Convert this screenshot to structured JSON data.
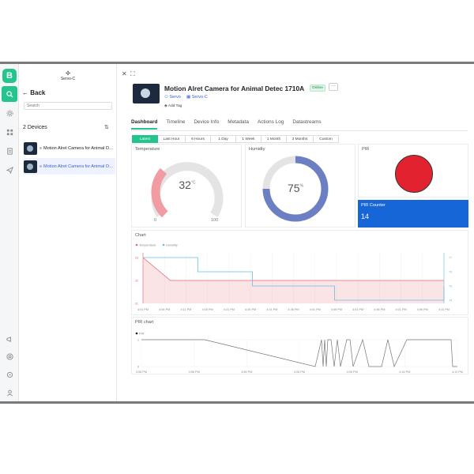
{
  "sidebar": {
    "logo": "B"
  },
  "devices_panel": {
    "org": "Servo-C",
    "back_label": "Back",
    "search_placeholder": "Search",
    "count_label": "2 Devices",
    "items": [
      {
        "name": "Motion Alret Camera for Animal Detec"
      },
      {
        "name": "Motion Alret Camera for Animal Detec"
      }
    ]
  },
  "device": {
    "title": "Motion Alret Camera for Animal Detec 1710A",
    "status": "Online",
    "template": "Servo",
    "org": "Servo-C",
    "add_tag": "Add Tag"
  },
  "tabs": [
    "Dashboard",
    "Timeline",
    "Device Info",
    "Metadata",
    "Actions Log",
    "Datastreams"
  ],
  "ranges": [
    "Latest",
    "Last Hour",
    "6 Hours",
    "1 Day",
    "1 Week",
    "1 Month",
    "3 Months",
    "Custom"
  ],
  "widgets": {
    "temperature": {
      "title": "Temperature",
      "value": "32",
      "unit": "°C",
      "min": "0",
      "max": "100",
      "level": 0.32,
      "color": "#f09ca2"
    },
    "humidity": {
      "title": "Humidty",
      "value": "75",
      "unit": "%",
      "level": 0.75,
      "color": "#6c7fc2"
    },
    "pir": {
      "title": "PIR",
      "color": "#e2232f"
    },
    "pir_counter": {
      "title": "PIR Counter",
      "value": "14",
      "color": "#1666d8"
    }
  },
  "chart_data": [
    {
      "type": "line",
      "title": "Chart",
      "series": [
        {
          "name": "Temperature",
          "color": "#e26a72",
          "values": [
            33,
            32,
            32,
            32,
            32,
            32,
            32,
            32,
            32,
            32,
            32,
            32
          ]
        },
        {
          "name": "Humidity",
          "color": "#66bde8",
          "values": [
            77,
            77,
            76,
            76,
            75,
            75,
            75,
            74,
            74,
            74,
            74,
            75
          ]
        }
      ],
      "x": [
        "4:01 PM",
        "4:06 PM",
        "4:11 PM",
        "4:16 PM",
        "4:21 PM",
        "4:26 PM",
        "4:31 PM",
        "4:36 PM",
        "4:41 PM",
        "4:46 PM",
        "4:51 PM",
        "4:56 PM",
        "4:01 PM",
        "4:06 PM",
        "4:11 PM"
      ],
      "y_left_ticks": [
        "33",
        "32",
        "31"
      ],
      "y_right_ticks": [
        "77",
        "76",
        "75",
        "74"
      ]
    },
    {
      "type": "line",
      "title": "PIR chart",
      "series": [
        {
          "name": "PIR",
          "color": "#777777"
        }
      ],
      "x": [
        "3:56 PM",
        "3:56 PM",
        "3:56 PM",
        "4:06 PM",
        "4:06 PM",
        "4:16 PM",
        "4:11 PM"
      ],
      "y_ticks": [
        "1",
        "0"
      ]
    }
  ]
}
